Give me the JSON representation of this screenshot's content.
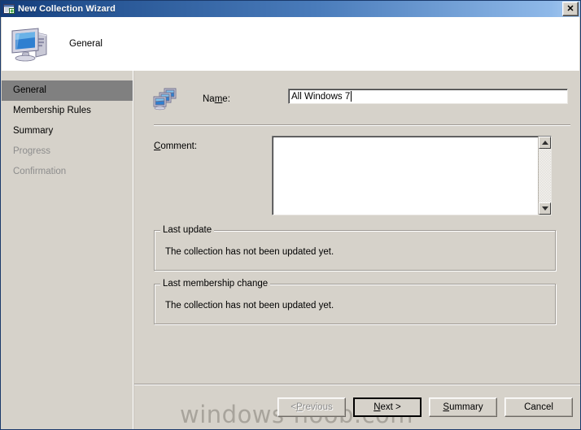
{
  "window": {
    "title": "New Collection Wizard",
    "title_icon": "new-collection-icon",
    "close_label": "✕",
    "titlebar_color_left": "#123a78",
    "titlebar_color_right": "#a9cbf0",
    "background": "#d6d2ca"
  },
  "header": {
    "title": "General",
    "icon": "computer-icon"
  },
  "sidebar": {
    "items": [
      {
        "label": "General",
        "state": "current"
      },
      {
        "label": "Membership Rules",
        "state": "enabled"
      },
      {
        "label": "Summary",
        "state": "enabled"
      },
      {
        "label": "Progress",
        "state": "disabled"
      },
      {
        "label": "Confirmation",
        "state": "disabled"
      }
    ],
    "highlight_color": "#808080"
  },
  "form": {
    "collection_icon": "collection-icon",
    "name": {
      "label_before": "Na",
      "label_accel": "m",
      "label_after": "e:",
      "value": "All Windows 7",
      "placeholder": ""
    },
    "comment": {
      "label_accel": "C",
      "label_after": "omment:",
      "value": "",
      "placeholder": ""
    },
    "groups": [
      {
        "legend": "Last update",
        "text": "The collection has not been updated yet."
      },
      {
        "legend": "Last membership change",
        "text": "The collection has not been updated yet."
      }
    ]
  },
  "footer": {
    "watermark": "windows-noob.com",
    "buttons": [
      {
        "label_before": "< ",
        "label_accel": "P",
        "label_after": "revious",
        "state": "disabled",
        "default": false
      },
      {
        "label_before": "",
        "label_accel": "N",
        "label_after": "ext >",
        "state": "enabled",
        "default": true
      },
      {
        "label_before": "",
        "label_accel": "S",
        "label_after": "ummary",
        "state": "enabled",
        "default": false
      },
      {
        "label_before": "Cancel",
        "label_accel": "",
        "label_after": "",
        "state": "enabled",
        "default": false
      }
    ]
  }
}
